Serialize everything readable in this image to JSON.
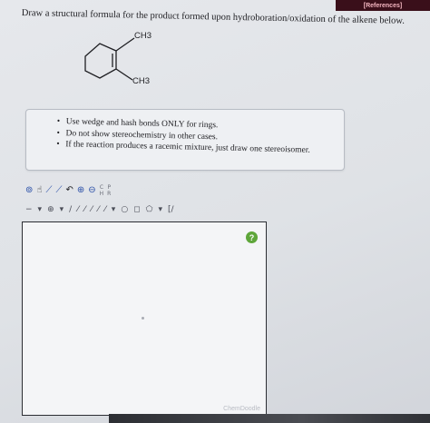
{
  "header": {
    "references_label": "[References]"
  },
  "question": {
    "text": "Draw a structural formula for the product formed upon hydroboration/oxidation of the alkene below."
  },
  "molecule": {
    "substituent_top": "CH3",
    "substituent_bottom": "CH3"
  },
  "rules": [
    "Use wedge and hash bonds ONLY for rings.",
    "Do not show stereochemistry in other cases.",
    "If the reaction produces a racemic mixture, just draw one stereoisomer."
  ],
  "toolbar1": {
    "tools": [
      {
        "name": "lasso-tool",
        "glyph": "⊚"
      },
      {
        "name": "hand-tool",
        "glyph": "☝"
      },
      {
        "name": "erase-tool",
        "glyph": "⟋"
      },
      {
        "name": "draw-tool",
        "glyph": "⟋"
      },
      {
        "name": "rotate-tool",
        "glyph": "↶"
      },
      {
        "name": "zoom-in-tool",
        "glyph": "⊕"
      },
      {
        "name": "zoom-out-tool",
        "glyph": "⊖"
      }
    ],
    "element_c": "C",
    "element_c_sub": "H",
    "element_p": "P",
    "element_p_sub": "R"
  },
  "toolbar2": {
    "items": [
      "−",
      "▾",
      "⊕",
      "▾",
      "/",
      "⁄",
      "⁄",
      "⁄",
      "⁄",
      "⁄",
      "▾",
      "○",
      "◻",
      "⬠",
      "▾",
      "[/"
    ]
  },
  "canvas": {
    "help_icon": "?",
    "watermark": "ChemDoodle"
  },
  "colors": {
    "reference_bg": "#3a0f1a",
    "help_button": "#5ea63a"
  }
}
